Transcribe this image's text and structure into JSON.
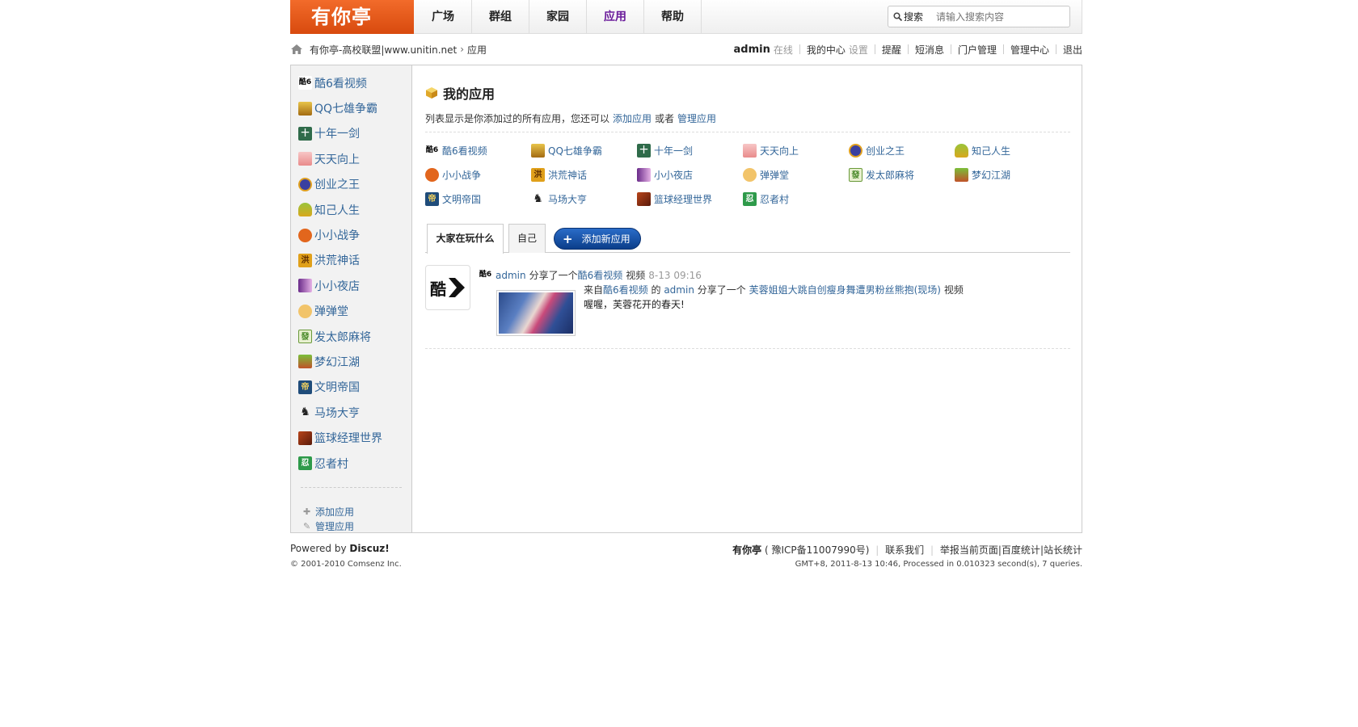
{
  "header": {
    "logo_text": "有你亭",
    "nav": [
      "广场",
      "群组",
      "家园",
      "应用",
      "帮助"
    ],
    "active_nav": "应用",
    "search_button": "搜索",
    "search_placeholder": "请输入搜索内容"
  },
  "breadcrumb": {
    "site": "有你亭-高校联盟|www.unitin.net",
    "current": "应用"
  },
  "userbar": {
    "username": "admin",
    "status": "在线",
    "center": "我的中心",
    "settings": "设置",
    "remind": "提醒",
    "messages": "短消息",
    "portal_manage": "门户管理",
    "admin_center": "管理中心",
    "logout": "退出"
  },
  "sidebar": {
    "apps": [
      "酷6看视频",
      "QQ七雄争霸",
      "十年一剑",
      "天天向上",
      "创业之王",
      "知己人生",
      "小小战争",
      "洪荒神话",
      "小小夜店",
      "弹弹堂",
      "发太郎麻将",
      "梦幻江湖",
      "文明帝国",
      "马场大亨",
      "篮球经理世界",
      "忍者村"
    ],
    "add_app": "添加应用",
    "manage_app": "管理应用"
  },
  "content": {
    "title": "我的应用",
    "desc_prefix": "列表显示是你添加过的所有应用，您还可以",
    "desc_add": "添加应用",
    "desc_or": "或者",
    "desc_manage": "管理应用",
    "apps": [
      "酷6看视频",
      "QQ七雄争霸",
      "十年一剑",
      "天天向上",
      "创业之王",
      "知己人生",
      "小小战争",
      "洪荒神话",
      "小小夜店",
      "弹弹堂",
      "发太郎麻将",
      "梦幻江湖",
      "文明帝国",
      "马场大亨",
      "篮球经理世界",
      "忍者村"
    ]
  },
  "tabs": {
    "everyone": "大家在玩什么",
    "self": "自己",
    "add_new": "添加新应用"
  },
  "feed": {
    "user": "admin",
    "action": "分享了一个",
    "app": "酷6看视频",
    "type": "视频",
    "time": "8-13 09:16",
    "from_prefix": "来自",
    "from_app": "酷6看视频",
    "of": "的",
    "from_user": "admin",
    "shared": "分享了一个",
    "video_title": "芙蓉姐姐大跳自创瘦身舞遭男粉丝熊抱(现场)",
    "video_word": "视频",
    "comment": "喔喔，芙蓉花开的春天!"
  },
  "footer": {
    "powered_prefix": "Powered by",
    "powered_brand": "Discuz!",
    "copyright": "© 2001-2010 Comsenz Inc.",
    "site_name": "有你亭",
    "icp": "( 豫ICP备11007990号)",
    "contact": "联系我们",
    "report": "举报当前页面",
    "baidu": "百度统计",
    "stats": "站长统计",
    "process": "GMT+8, 2011-8-13 10:46, Processed in 0.010323 second(s), 7 queries."
  },
  "icons": [
    "ku6-icon",
    "qq-qixiong-icon",
    "shinian-icon",
    "tiantian-icon",
    "chuangye-icon",
    "zhiji-icon",
    "xiaoxiao-zhanzheng-icon",
    "honghuang-icon",
    "yedian-icon",
    "dandantang-icon",
    "mahjong-icon",
    "menghuan-icon",
    "wenming-icon",
    "horse-icon",
    "basketball-icon",
    "ninja-icon"
  ]
}
